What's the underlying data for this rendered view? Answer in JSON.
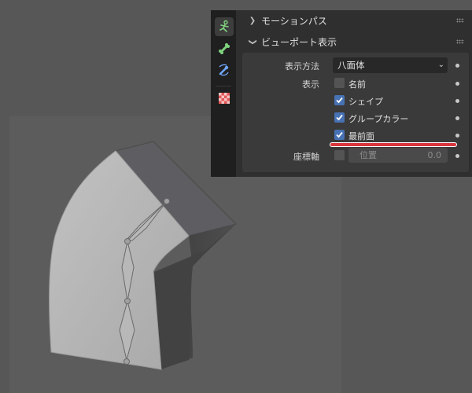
{
  "colors": {
    "viewport_bg": "#575757",
    "panel_bg": "#2f2f2f",
    "checkbox_checked": "#4772b3",
    "highlight_underline": "#d9363e"
  },
  "tabs": [
    {
      "icon": "object-data-pose-icon",
      "active": true
    },
    {
      "icon": "bone-icon",
      "active": false
    },
    {
      "icon": "bone-constraint-icon",
      "active": false
    },
    {
      "icon": "texture-checker-icon",
      "active": false
    }
  ],
  "panels": {
    "motion_paths": {
      "title": "モーションパス",
      "expanded": false
    },
    "viewport_display": {
      "title": "ビューポート表示",
      "expanded": true,
      "display_as": {
        "label": "表示方法",
        "value": "八面体"
      },
      "show": {
        "label": "表示"
      },
      "names": {
        "label": "名前",
        "checked": false
      },
      "shapes": {
        "label": "シェイプ",
        "checked": true
      },
      "group_colors": {
        "label": "グループカラー",
        "checked": true
      },
      "in_front": {
        "label": "最前面",
        "checked": true
      },
      "axes": {
        "label": "座標軸",
        "checked": false,
        "position_label": "位置",
        "position_value": "0.0"
      }
    }
  }
}
